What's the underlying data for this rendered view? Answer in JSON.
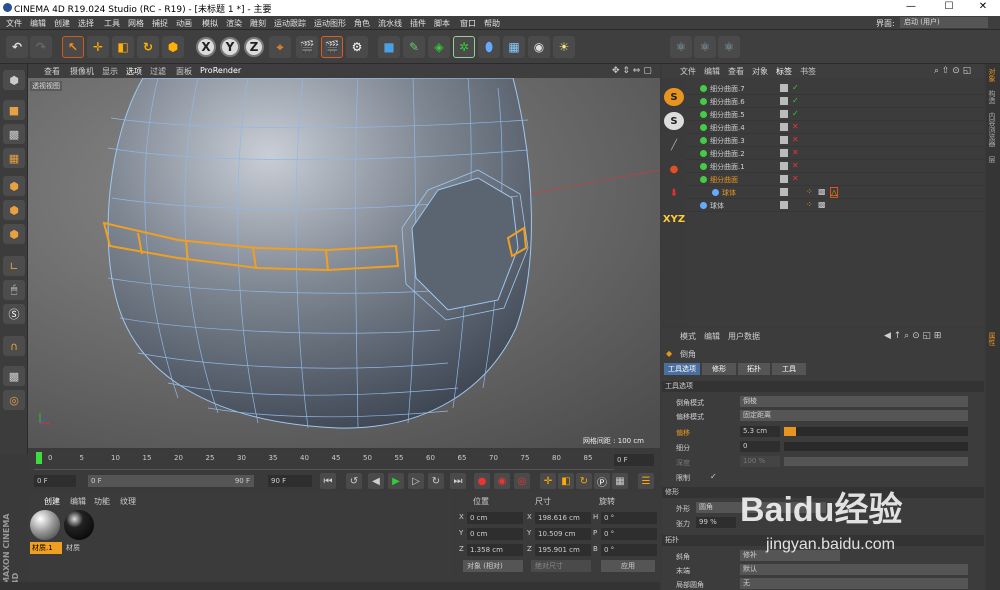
{
  "window": {
    "title": "CINEMA 4D R19.024 Studio (RC - R19) - [未标题 1 *] - 主要",
    "minimize": "—",
    "maximize": "☐",
    "close": "✕"
  },
  "menu": {
    "items": [
      "文件",
      "编辑",
      "创建",
      "选择",
      "工具",
      "网格",
      "捕捉",
      "动画",
      "模拟",
      "渲染",
      "雕刻",
      "运动跟踪",
      "运动图形",
      "角色",
      "流水线",
      "插件",
      "脚本",
      "窗口",
      "帮助"
    ],
    "layout_label": "界面:",
    "layout_value": "启动 (用户)"
  },
  "toolbar": {
    "x": "X",
    "y": "Y",
    "z": "Z"
  },
  "viewport": {
    "menu": [
      "查看",
      "摄像机",
      "显示",
      "选项",
      "过滤",
      "面板",
      "ProRender"
    ],
    "label": "透视视图",
    "grid": "网格间距 : 100 cm"
  },
  "timeline": {
    "ticks": [
      "0",
      "5",
      "10",
      "15",
      "20",
      "25",
      "30",
      "35",
      "40",
      "45",
      "50",
      "55",
      "60",
      "65",
      "70",
      "75",
      "80",
      "85",
      "90"
    ],
    "frame": "0 F"
  },
  "playback": {
    "start": "0 F",
    "current": "0 F",
    "end_small": "90 F",
    "end": "90 F"
  },
  "materials": {
    "menu": [
      "创建",
      "编辑",
      "功能",
      "纹理"
    ],
    "items": [
      {
        "name": "材质.1"
      },
      {
        "name": "材质"
      }
    ]
  },
  "coords": {
    "headers": [
      "位置",
      "尺寸",
      "旋转"
    ],
    "rows": [
      {
        "axis": "X",
        "pos": "0 cm",
        "size": "198.616 cm",
        "rot_axis": "H",
        "rot": "0 °"
      },
      {
        "axis": "Y",
        "pos": "0 cm",
        "size": "10.509 cm",
        "rot_axis": "P",
        "rot": "0 °"
      },
      {
        "axis": "Z",
        "pos": "1.358 cm",
        "size": "195.901 cm",
        "rot_axis": "B",
        "rot": "0 °"
      }
    ],
    "mode": "对象 (相对)",
    "size_mode": "绝对尺寸",
    "apply": "应用"
  },
  "objects": {
    "menu": [
      "文件",
      "编辑",
      "查看",
      "对象",
      "标签",
      "书签"
    ],
    "rows": [
      {
        "name": "细分曲面.7",
        "status": "✓"
      },
      {
        "name": "细分曲面.6",
        "status": "✓"
      },
      {
        "name": "细分曲面.5",
        "status": "✓"
      },
      {
        "name": "细分曲面.4",
        "status": "✕"
      },
      {
        "name": "细分曲面.3",
        "status": "✕"
      },
      {
        "name": "细分曲面.2",
        "status": "✕"
      },
      {
        "name": "细分曲面.1",
        "status": "✕"
      },
      {
        "name": "细分曲面",
        "status": "✕"
      },
      {
        "name": "球体",
        "status": ""
      },
      {
        "name": "球体",
        "status": ""
      }
    ]
  },
  "attributes": {
    "menu": [
      "模式",
      "编辑",
      "用户数据"
    ],
    "title": "倒角",
    "tabs": [
      "工具选项",
      "修形",
      "拓扑",
      "工具"
    ],
    "sections": {
      "tool": "工具选项",
      "shape": "修形",
      "topology": "拓扑"
    },
    "fields": [
      {
        "label": "倒角模式",
        "value": "倒棱"
      },
      {
        "label": "偏移模式",
        "value": "固定距离"
      },
      {
        "label": "偏移",
        "value": "5.3 cm"
      },
      {
        "label": "细分",
        "value": "0"
      },
      {
        "label": "深度",
        "value": "100 %"
      },
      {
        "label": "限制",
        "value": "✓"
      }
    ],
    "shape_fields": [
      {
        "label": "外形",
        "value": "圆角"
      },
      {
        "label": "张力",
        "value": "99 %"
      }
    ],
    "topo_fields": [
      {
        "label": "斜角",
        "value": "修补"
      },
      {
        "label": "末端",
        "value": "默认"
      },
      {
        "label": "局部圆角",
        "value": "无"
      }
    ]
  },
  "right_tabs": [
    "对象",
    "构造",
    "内容浏览器",
    "层",
    "属性"
  ],
  "branding": {
    "maxon": "MAXON CINEMA 4D"
  },
  "watermark": {
    "text": "Baidu经验",
    "url": "jingyan.baidu.com"
  }
}
